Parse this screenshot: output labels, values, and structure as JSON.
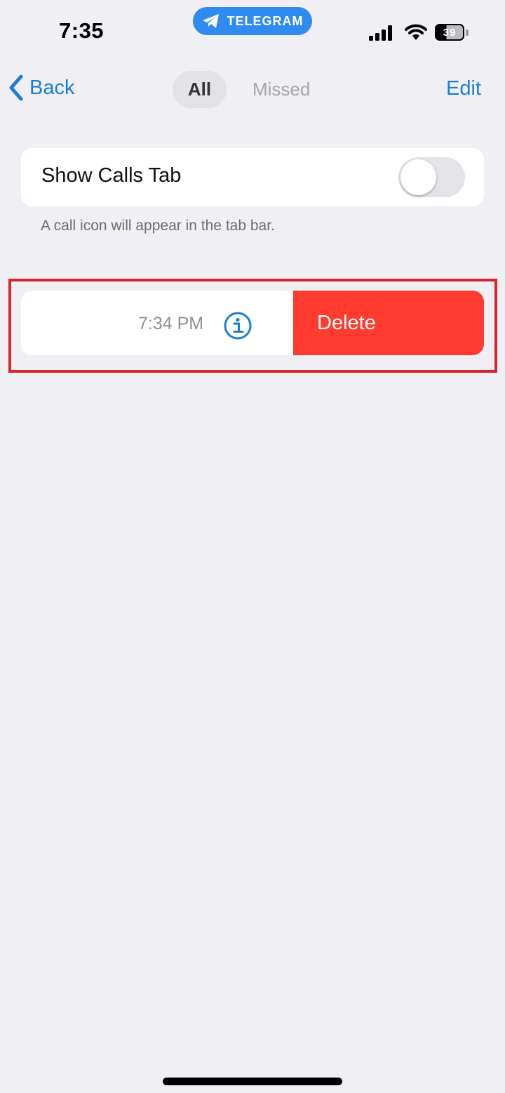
{
  "status_bar": {
    "time": "7:35",
    "app_indicator": "TELEGRAM",
    "battery": "39",
    "icons": [
      "telegram-plane-icon",
      "signal-icon",
      "wifi-icon",
      "battery-icon"
    ]
  },
  "nav": {
    "back_label": "Back",
    "segments": [
      {
        "label": "All",
        "selected": true
      },
      {
        "label": "Missed",
        "selected": false
      }
    ],
    "edit_label": "Edit"
  },
  "settings": {
    "show_calls_tab_label": "Show Calls Tab",
    "show_calls_tab_enabled": false,
    "footer": "A call icon will appear in the tab bar."
  },
  "calls": [
    {
      "time": "7:34 PM",
      "info_icon": "info-icon",
      "action_label": "Delete"
    }
  ],
  "colors": {
    "accent": "#1a7fd4",
    "telegram_pill": "#2f8bf0",
    "delete": "#ff3b2f",
    "highlight": "#d8242c",
    "background": "#efeff4"
  }
}
